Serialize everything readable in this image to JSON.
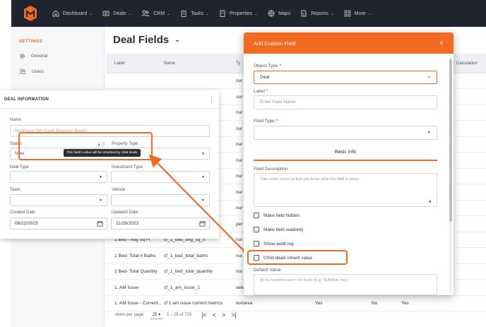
{
  "nav": {
    "items": [
      {
        "label": "Dashboard",
        "icon": "home-icon",
        "chevron": true
      },
      {
        "label": "Deals",
        "icon": "deals-icon",
        "chevron": true
      },
      {
        "label": "CRM",
        "icon": "crm-icon",
        "chevron": true
      },
      {
        "label": "Tasks",
        "icon": "tasks-icon",
        "chevron": true
      },
      {
        "label": "Properties",
        "icon": "properties-icon",
        "chevron": true
      },
      {
        "label": "Maps",
        "icon": "maps-icon",
        "chevron": false
      },
      {
        "label": "Reports",
        "icon": "reports-icon",
        "chevron": true
      },
      {
        "label": "More",
        "icon": "more-icon",
        "chevron": true
      }
    ]
  },
  "sidebar": {
    "heading": "SETTINGS",
    "items": [
      {
        "label": "General",
        "icon": "gear-icon"
      },
      {
        "label": "Users",
        "icon": "users-icon"
      }
    ]
  },
  "main": {
    "title": "Deal Fields",
    "columns": [
      "Label",
      "Name",
      "Ty",
      "Calculation"
    ],
    "rows": [
      {
        "label": "",
        "name": "",
        "type": "nur",
        "c4": "",
        "c5": "",
        "c6": ""
      },
      {
        "label": "",
        "name": "",
        "type": "nur",
        "c4": "",
        "c5": "",
        "c6": ""
      },
      {
        "label": "",
        "name": "",
        "type": "nur",
        "c4": "",
        "c5": "",
        "c6": ""
      },
      {
        "label": "",
        "name": "",
        "type": "nur",
        "c4": "",
        "c5": "",
        "c6": ""
      },
      {
        "label": "",
        "name": "",
        "type": "nur",
        "c4": "",
        "c5": "",
        "c6": ""
      },
      {
        "label": "",
        "name": "",
        "type": "nur",
        "c4": "",
        "c5": "",
        "c6": ""
      },
      {
        "label": "",
        "name": "",
        "type": "nur",
        "c4": "",
        "c5": "",
        "c6": ""
      },
      {
        "label": "",
        "name": "",
        "type": "nur",
        "c4": "",
        "c5": "",
        "c6": ""
      },
      {
        "label": "",
        "name": "",
        "type": "nur",
        "c4": "",
        "c5": "",
        "c6": ""
      },
      {
        "label": "",
        "name": "",
        "type": "per",
        "c4": "",
        "c5": "",
        "c6": ""
      },
      {
        "label": "1 Bed - Avg Sq Ft",
        "name": "cf_1_bed_avg_sq_ft",
        "type": "nur",
        "c4": "",
        "c5": "",
        "c6": ""
      },
      {
        "label": "1 Bed- Total # Baths",
        "name": "cf_1_bed_total_baths",
        "type": "nur",
        "c4": "",
        "c5": "",
        "c6": ""
      },
      {
        "label": "1 Bed- Total Quantity",
        "name": "cf_1_bed_total_quantity",
        "type": "nur",
        "c4": "",
        "c5": "",
        "c6": ""
      },
      {
        "label": "1. AM Issue",
        "name": "cf_1_am_issue_1",
        "type": "sele",
        "c4": "",
        "c5": "",
        "c6": ""
      },
      {
        "label": "1. AM Issue - Current...",
        "name": "cf 1 am issue current metrics",
        "type": "textarea",
        "c4": "Yes",
        "c5": "No",
        "c6": "Yes"
      }
    ],
    "pager": {
      "items_per_page_label": "Items per page:",
      "per_page": "25",
      "range": "1 – 25 of 733",
      "first": "|<",
      "prev": "<",
      "next": ">",
      "last": ">|"
    }
  },
  "deal_panel": {
    "title": "DEAL INFORMATION",
    "name_label": "Name",
    "name_value": "Northeast 8th Court Boynton Beach",
    "status_label": "Status",
    "status_value": "New",
    "property_type_label": "Property Type",
    "tooltip": "This field's value will be inherited by child deals.",
    "deal_type_label": "Deal Type",
    "investment_type_label": "Investment Type",
    "team_label": "Team",
    "vehicle_label": "Vehicle",
    "created_date_label": "Created Date",
    "created_date_value": "08/22/2023",
    "updated_date_label": "Updated Date",
    "updated_date_value": "11/29/2023"
  },
  "modal": {
    "title": "Add Custom Field",
    "close": "×",
    "object_type_label": "Object Type *",
    "object_type_value": "Deal",
    "label_label": "Label *",
    "label_placeholder": "Enter Field Name",
    "field_type_label": "Field Type *",
    "tab_basic_info": "Basic info",
    "field_description_label": "Field Description",
    "field_description_placeholder": "Take some notes so that you know what this field is about.",
    "checkboxes": [
      {
        "label": "Make field hidden"
      },
      {
        "label": "Make field readonly"
      },
      {
        "label": "Show audit log"
      },
      {
        "label": "Child deals inherit value"
      }
    ],
    "default_value_label": "Default Value",
    "default_value_placeholder": "@ for functions and # for fields (E.g. SUM(fair, no) )"
  },
  "colors": {
    "accent": "#f26a21",
    "nav_bg": "#1f2430"
  }
}
